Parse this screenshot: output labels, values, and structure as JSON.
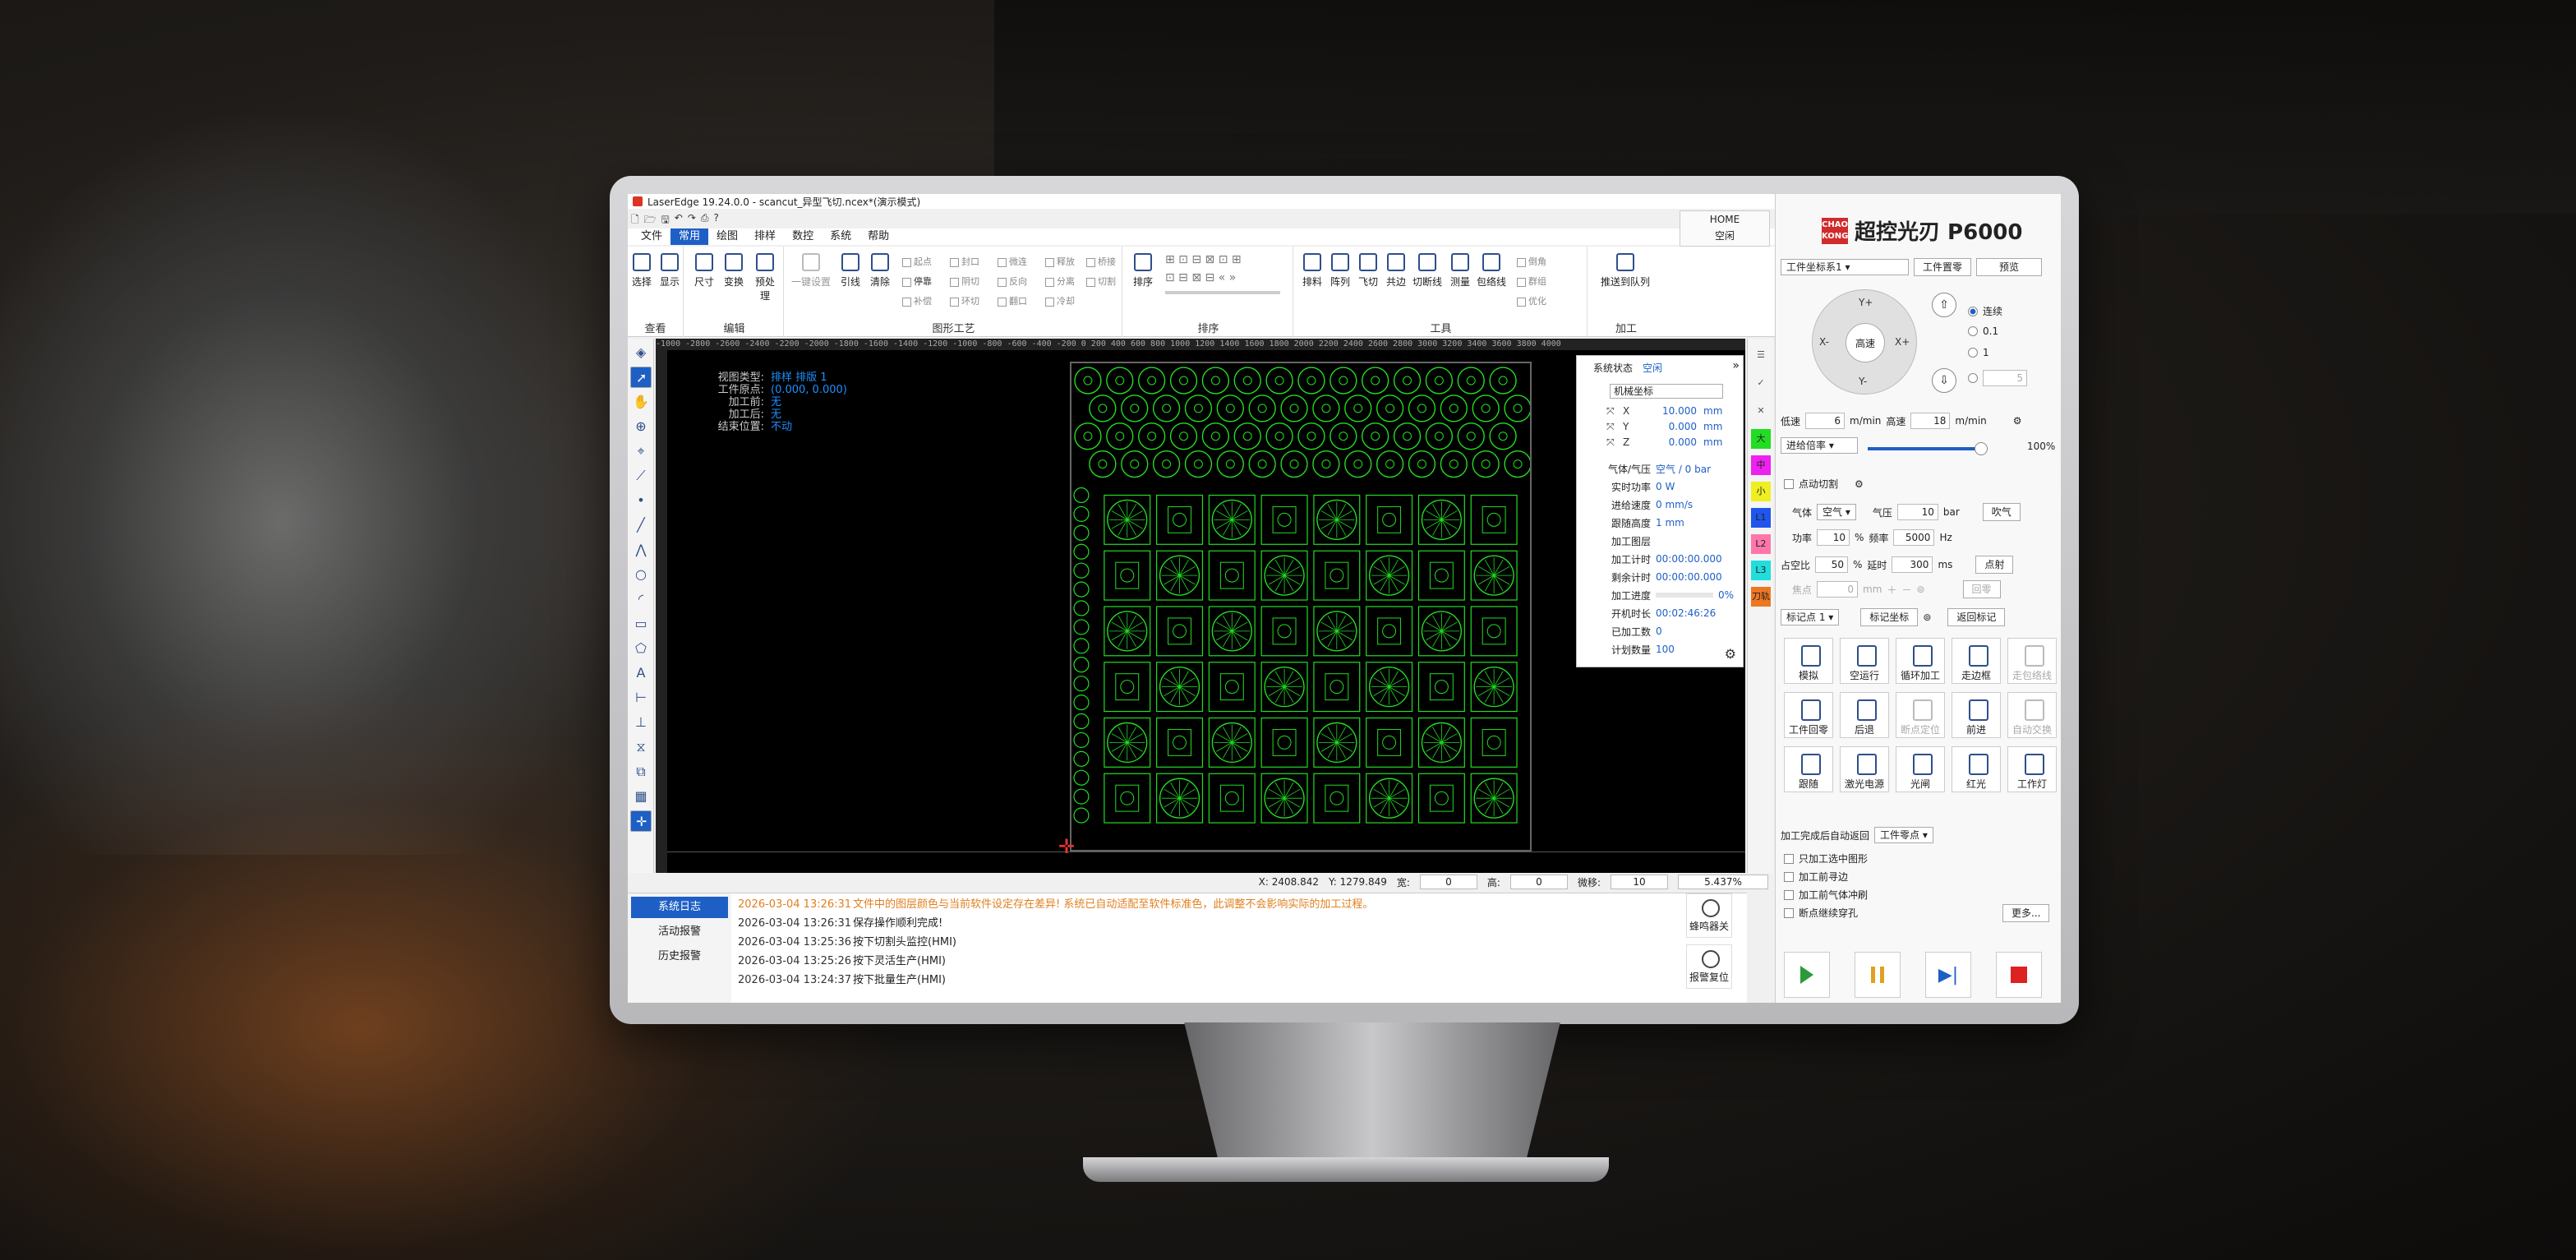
{
  "window": {
    "title": "LaserEdge 19.24.0.0 - scancut_异型飞切.ncex*(演示模式)",
    "controls": [
      "—",
      "❐",
      "✕"
    ]
  },
  "home": {
    "label": "HOME",
    "sub": "空闲"
  },
  "menu": [
    "文件",
    "常用",
    "绘图",
    "排样",
    "数控",
    "系统",
    "帮助"
  ],
  "ribbon": {
    "groups": [
      "查看",
      "编辑",
      "图形工艺",
      "排序",
      "工具",
      "加工"
    ],
    "view": [
      "选择",
      "显示"
    ],
    "edit": [
      "尺寸",
      "变换",
      "预处理"
    ],
    "craft": [
      "一键设置",
      "引线",
      "清除"
    ],
    "craft_small": [
      "起点",
      "封口",
      "微连",
      "释放",
      "桥接",
      "停靠",
      "阴切",
      "反向",
      "分离",
      "切割",
      "补偿",
      "环切",
      "翻口",
      "冷却"
    ],
    "sort": [
      "排序"
    ],
    "tools": [
      "排料",
      "阵列",
      "飞切",
      "共边",
      "切断线",
      "测量",
      "包络线"
    ],
    "tools_small": [
      "倒角",
      "群组",
      "优化"
    ],
    "process": [
      "推送到队列"
    ]
  },
  "canvas": {
    "ruler": "-1000  -2800  -2600  -2400  -2200  -2000  -1800  -1600  -1400  -1200  -1000  -800  -600  -400  -200  0  200  400  600  800  1000  1200  1400  1600  1800  2000  2200  2400  2600  2800  3000  3200  3400  3600  3800  4000",
    "info": [
      {
        "k": "视图类型:",
        "v": "排样 排版 1"
      },
      {
        "k": "工件原点:",
        "v": "(0.000, 0.000)"
      },
      {
        "k": "加工前:",
        "v": "无"
      },
      {
        "k": "加工后:",
        "v": "无"
      },
      {
        "k": "结束位置:",
        "v": "不动"
      }
    ],
    "line_color": "#22dd22"
  },
  "status": {
    "x": "X: 2408.842",
    "y": "Y: 1279.849",
    "w_label": "宽:",
    "w": "0",
    "h_label": "高:",
    "h": "0",
    "step_label": "微移:",
    "step": "10",
    "zoom": "5.437%"
  },
  "system_status": {
    "title": "系统状态",
    "state": "空闲",
    "coord_mode": "机械坐标",
    "coords": [
      {
        "axis": "X",
        "val": "10.000",
        "unit": "mm"
      },
      {
        "axis": "Y",
        "val": "0.000",
        "unit": "mm"
      },
      {
        "axis": "Z",
        "val": "0.000",
        "unit": "mm"
      }
    ],
    "rows": [
      {
        "k": "气体/气压",
        "v": "空气 / 0 bar"
      },
      {
        "k": "实时功率",
        "v": "0 W"
      },
      {
        "k": "进给速度",
        "v": "0 mm/s"
      },
      {
        "k": "跟随高度",
        "v": "1 mm"
      },
      {
        "k": "加工图层",
        "v": ""
      },
      {
        "k": "加工计时",
        "v": "00:00:00.000"
      },
      {
        "k": "剩余计时",
        "v": "00:00:00.000"
      },
      {
        "k": "加工进度",
        "v": "0%"
      },
      {
        "k": "开机时长",
        "v": "00:02:46:26"
      },
      {
        "k": "已加工数",
        "v": "0"
      },
      {
        "k": "计划数量",
        "v": "100"
      }
    ]
  },
  "layers": [
    {
      "label": "大",
      "color": "#22dd22"
    },
    {
      "label": "中",
      "color": "#ee22ee"
    },
    {
      "label": "小",
      "color": "#eeee22"
    },
    {
      "label": "L1",
      "color": "#2255ee"
    },
    {
      "label": "L2",
      "color": "#ff77aa"
    },
    {
      "label": "L3",
      "color": "#22dddd"
    },
    {
      "label": "刀轨",
      "color": "#ee7722"
    }
  ],
  "logs": {
    "tabs": [
      "系统日志",
      "活动报警",
      "历史报警"
    ],
    "rows": [
      {
        "t": "2026-03-04 13:26:31",
        "m": "文件中的图层颜色与当前软件设定存在差异! 系统已自动适配至软件标准色，此调整不会影响实际的加工过程。",
        "warn": true
      },
      {
        "t": "2026-03-04 13:26:31",
        "m": "保存操作顺利完成!",
        "warn": false
      },
      {
        "t": "2026-03-04 13:25:36",
        "m": "按下切割头监控(HMI)",
        "warn": false
      },
      {
        "t": "2026-03-04 13:25:26",
        "m": "按下灵活生产(HMI)",
        "warn": false
      },
      {
        "t": "2026-03-04 13:24:37",
        "m": "按下批量生产(HMI)",
        "warn": false
      }
    ],
    "side_buttons": [
      "蜂鸣器关",
      "报警复位"
    ]
  },
  "right_panel": {
    "brand_badge": "CHAO KONG",
    "brand": "超控光刃 P6000",
    "coord_system": "工件坐标系1",
    "btn_workzero": "工件置零",
    "btn_preview": "预览",
    "jog": {
      "up": "Y+",
      "down": "Y-",
      "left": "X-",
      "right": "X+",
      "center": "高速"
    },
    "modes": [
      "连续",
      "0.1",
      "1",
      "5"
    ],
    "low_speed_label": "低速",
    "low_speed": "6",
    "speed_unit": "m/min",
    "high_speed_label": "高速",
    "high_speed": "18",
    "feed_rate_label": "进给倍率",
    "feed_rate": "100%",
    "feed_rate_fraction": 1.0,
    "point_cut": "点动切割",
    "gas_label": "气体",
    "gas": "空气",
    "pressure_label": "气压",
    "pressure": "10",
    "pressure_unit": "bar",
    "blow": "吹气",
    "power_label": "功率",
    "power": "10",
    "pct": "%",
    "freq_label": "频率",
    "freq": "5000",
    "freq_unit": "Hz",
    "duty_label": "占空比",
    "duty": "50",
    "delay_label": "延时",
    "delay": "300",
    "delay_unit": "ms",
    "pulse": "点射",
    "focus_label": "焦点",
    "focus": "0",
    "focus_unit": "mm",
    "refocus": "回零",
    "mark": "标记点 1",
    "mark_coord": "标记坐标",
    "return_mark": "返回标记",
    "grid": [
      {
        "label": "模拟",
        "enabled": true
      },
      {
        "label": "空运行",
        "enabled": true
      },
      {
        "label": "循环加工",
        "enabled": true
      },
      {
        "label": "走边框",
        "enabled": true
      },
      {
        "label": "走包络线",
        "enabled": false
      },
      {
        "label": "工件回零",
        "enabled": true
      },
      {
        "label": "后退",
        "enabled": true
      },
      {
        "label": "断点定位",
        "enabled": false
      },
      {
        "label": "前进",
        "enabled": true
      },
      {
        "label": "自动交换",
        "enabled": false
      },
      {
        "label": "跟随",
        "enabled": true
      },
      {
        "label": "激光电源",
        "enabled": true
      },
      {
        "label": "光闸",
        "enabled": true
      },
      {
        "label": "红光",
        "enabled": true
      },
      {
        "label": "工作灯",
        "enabled": true
      }
    ],
    "after_finish_label": "加工完成后自动返回",
    "after_finish": "工件零点",
    "checks": [
      "只加工选中图形",
      "加工前寻边",
      "加工前气体冲刷",
      "断点继续穿孔"
    ],
    "more": "更多..."
  }
}
